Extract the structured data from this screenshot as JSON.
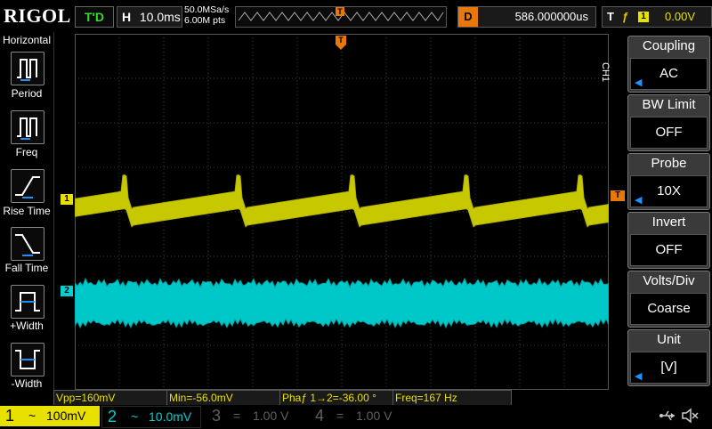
{
  "header": {
    "brand": "RIGOL",
    "run_status": "T'D",
    "timebase_key": "H",
    "timebase_value": "10.0ms",
    "sample_rate": "50.0MSa/s",
    "memory_depth": "6.00M pts",
    "trigger_pos_marker": "T",
    "delay_key": "D",
    "delay_value": "586.000000us",
    "trigger_key": "T",
    "trigger_edge": "ƒ",
    "trigger_source": "1",
    "trigger_level": "0.00V"
  },
  "left_menu": {
    "title": "Horizontal",
    "items": [
      {
        "label": "Period",
        "icon": "period-icon"
      },
      {
        "label": "Freq",
        "icon": "freq-icon"
      },
      {
        "label": "Rise Time",
        "icon": "rise-time-icon"
      },
      {
        "label": "Fall Time",
        "icon": "fall-time-icon"
      },
      {
        "label": "+Width",
        "icon": "plus-width-icon"
      },
      {
        "label": "-Width",
        "icon": "minus-width-icon"
      }
    ]
  },
  "right_menu": {
    "channel_tag": "CH1",
    "items": [
      {
        "title": "Coupling",
        "value": "AC",
        "arrow": true
      },
      {
        "title": "BW Limit",
        "value": "OFF",
        "arrow": false
      },
      {
        "title": "Probe",
        "value": "10X",
        "arrow": true
      },
      {
        "title": "Invert",
        "value": "OFF",
        "arrow": false
      },
      {
        "title": "Volts/Div",
        "value": "Coarse",
        "arrow": false
      },
      {
        "title": "Unit",
        "value": "[V]",
        "arrow": true
      }
    ]
  },
  "waveforms": {
    "ch1_marker": "1",
    "ch2_marker": "2",
    "trigger_level_marker": "T",
    "ch1_color": "#c8c800",
    "ch2_color": "#00c8c8"
  },
  "measurements": {
    "vpp": "Vpp=160mV",
    "min": "Min=-56.0mV",
    "phase": "Phaƒ 1→2=-36.00 °",
    "freq": "Freq=167 Hz"
  },
  "channels": [
    {
      "num": "1",
      "coupling": "~",
      "scale": "100mV",
      "active": true,
      "color": "#e8e000"
    },
    {
      "num": "2",
      "coupling": "~",
      "scale": "10.0mV",
      "active": true,
      "color": "#00d0d0"
    },
    {
      "num": "3",
      "coupling": "=",
      "scale": "1.00 V",
      "active": false,
      "color": "#606060"
    },
    {
      "num": "4",
      "coupling": "=",
      "scale": "1.00 V",
      "active": false,
      "color": "#606060"
    }
  ],
  "status_icons": [
    "usb-icon",
    "speaker-muted-icon"
  ]
}
